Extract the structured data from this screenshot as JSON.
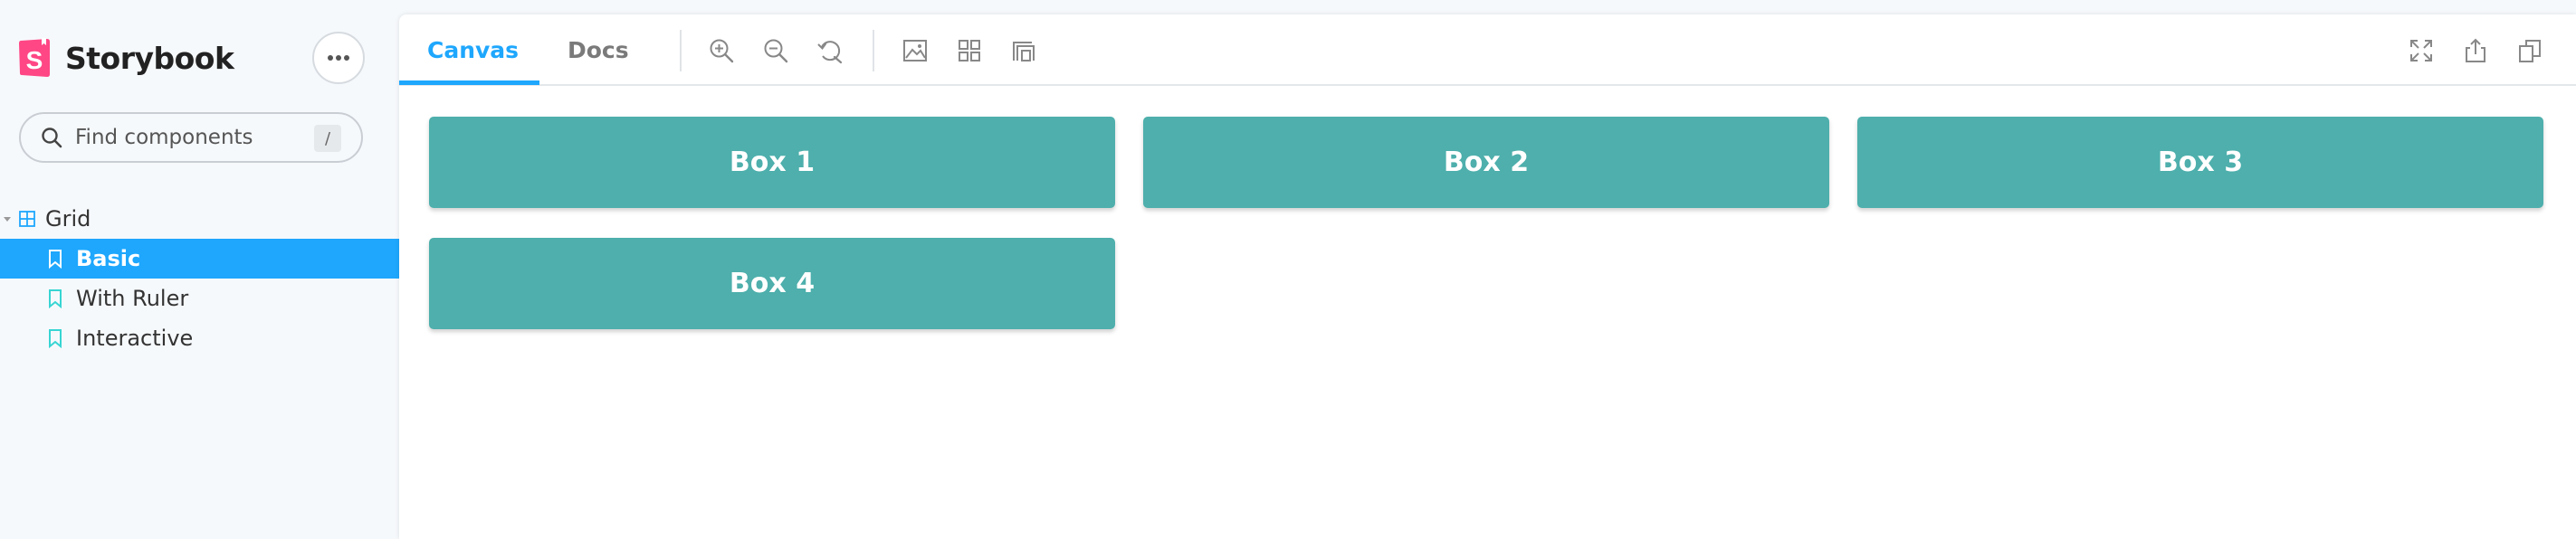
{
  "brand": {
    "name": "Storybook",
    "logo_letter": "S"
  },
  "search": {
    "placeholder": "Find components",
    "shortcut": "/"
  },
  "tree": {
    "group": {
      "label": "Grid"
    },
    "stories": [
      {
        "label": "Basic",
        "active": true
      },
      {
        "label": "With Ruler",
        "active": false
      },
      {
        "label": "Interactive",
        "active": false
      }
    ]
  },
  "tabs": [
    {
      "label": "Canvas",
      "active": true
    },
    {
      "label": "Docs",
      "active": false
    }
  ],
  "toolbar_icons": [
    "zoom-in-icon",
    "zoom-out-icon",
    "zoom-reset-icon",
    "background-icon",
    "grid-icon",
    "outline-icon",
    "fullscreen-icon",
    "share-icon",
    "copy-link-icon"
  ],
  "boxes": [
    {
      "label": "Box 1"
    },
    {
      "label": "Box 2"
    },
    {
      "label": "Box 3"
    },
    {
      "label": "Box 4"
    }
  ],
  "colors": {
    "accent": "#1ea7fd",
    "box": "#4eafac",
    "brand_pink": "#ff4785",
    "sidebar_bg": "#f6f9fc",
    "story_icon": "#37d5d3"
  }
}
